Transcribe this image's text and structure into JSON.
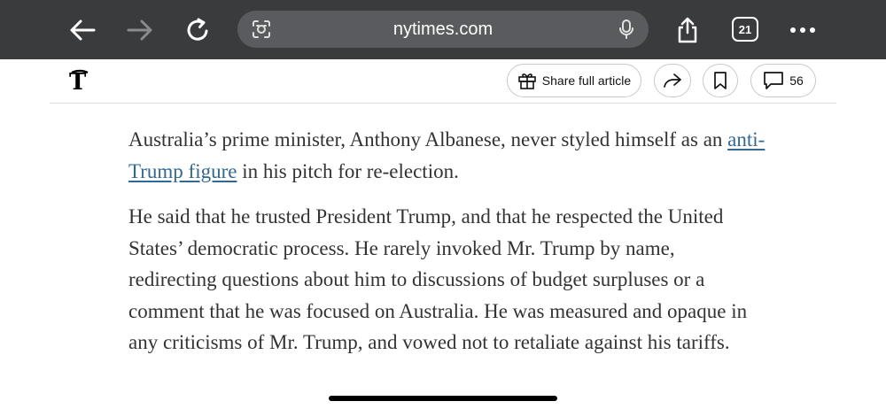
{
  "browser": {
    "url": "nytimes.com",
    "tab_count": "21",
    "icons": {
      "back": "back-arrow-icon",
      "forward": "forward-arrow-icon",
      "reload": "reload-icon",
      "lens": "visual-search-icon",
      "mic": "microphone-icon",
      "share": "share-icon",
      "more": "more-icon"
    },
    "forward_disabled": true
  },
  "toolbar": {
    "logo": "𝕿",
    "share_full_article_label": "Share full article",
    "comment_count": "56"
  },
  "article": {
    "p1_before_link": "Australia’s prime minister, Anthony Albanese, never styled himself as an ",
    "p1_link": "anti-Trump figure",
    "p1_after_link": " in his pitch for re-election.",
    "p2": "He said that he trusted President Trump, and that he respected the United States’ democratic process. He rarely invoked Mr. Trump by name, redirecting questions about him to discussions of budget surpluses or a comment that he was focused on Australia. He was measured and opaque in any criticisms of Mr. Trump, and vowed not to retaliate against his tariffs."
  },
  "colors": {
    "chrome_bg": "#3a3b3d",
    "url_bar_bg": "#5a5b5e",
    "link": "#326891",
    "body_text": "#333333"
  }
}
